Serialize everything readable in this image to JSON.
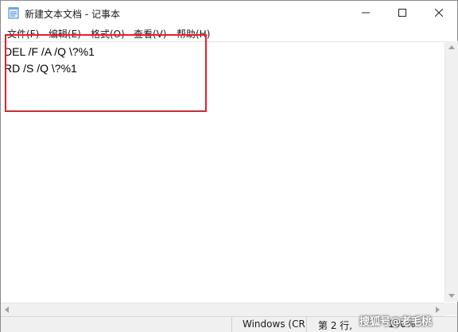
{
  "window": {
    "title": "新建文本文档 - 记事本"
  },
  "menu": [
    {
      "label": "文件(F)"
    },
    {
      "label": "编辑(E)"
    },
    {
      "label": "格式(O)"
    },
    {
      "label": "查看(V)"
    },
    {
      "label": "帮助(H)"
    }
  ],
  "editor": {
    "lines": [
      "DEL /F /A /Q \\?%1",
      "RD /S /Q \\?%1"
    ]
  },
  "status": {
    "line_ending": "Windows (CR",
    "position": "第 2 行,",
    "zoom": "100%"
  },
  "watermark": "搜狐号@老毛桃",
  "colors": {
    "highlight": "#e8202a",
    "statusbar": "#f0f0f0"
  }
}
